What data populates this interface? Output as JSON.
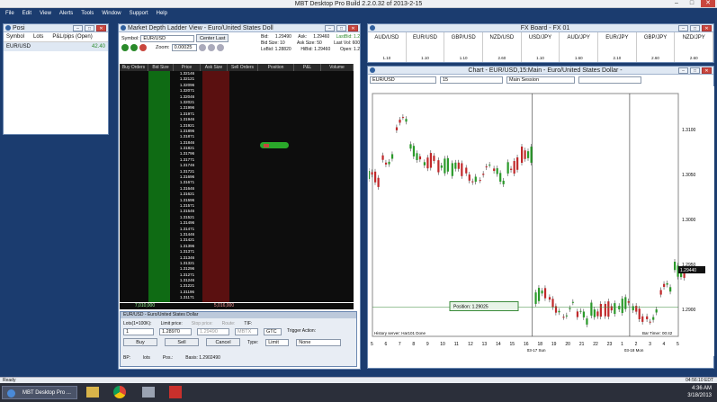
{
  "app": {
    "title": "MBT Desktop Pro Build 2.2.0.32 of 2013-2-15",
    "menu": [
      "File",
      "Edit",
      "View",
      "Alerts",
      "Tools",
      "Window",
      "Support",
      "Help"
    ]
  },
  "positions": {
    "title": "Posi",
    "headers": [
      "Symbol",
      "Lots",
      "P&L/pips (Open)"
    ],
    "rows": [
      {
        "symbol": "EUR/USD",
        "pl": "42.40"
      }
    ]
  },
  "ladder": {
    "title": "Market Depth Ladder View - Euro/United States Doll",
    "symbol_label": "Symbol:",
    "symbol": "EUR/USD",
    "center": "Center Last",
    "bid_label": "Bid:",
    "bid": "1.29490",
    "ask_label": "Ask:",
    "ask": "1.29460",
    "bidsize": "Bid Size: 10",
    "asksize": "Ask Size: 50",
    "lastbid": "LastBid: 1.2",
    "lobid": "LoBid: 1.28820",
    "hibid": "HiBid: 1.29460",
    "lastvol": "Last Vol: 600",
    "open": "Open: 1.2",
    "zoom_label": "Zoom:",
    "zoom": "0.00025",
    "columns": [
      "Buy Orders",
      "Bid Size",
      "Price",
      "Ask Size",
      "Sell Orders",
      "Position",
      "P&L",
      "Volume"
    ],
    "prices": [
      "1.32146",
      "1.32121",
      "1.32096",
      "1.32071",
      "1.32046",
      "1.32021",
      "1.31996",
      "1.31971",
      "1.31946",
      "1.31921",
      "1.31896",
      "1.31871",
      "1.31846",
      "1.31821",
      "1.31796",
      "1.31771",
      "1.31746",
      "1.31721",
      "1.31696",
      "1.31671",
      "1.31646",
      "1.31621",
      "1.31596",
      "1.31571",
      "1.31546",
      "1.31521",
      "1.31496",
      "1.31471",
      "1.31446",
      "1.31421",
      "1.31396",
      "1.31371",
      "1.31346",
      "1.31321",
      "1.31296",
      "1.31271",
      "1.31246",
      "1.31221",
      "1.31196",
      "1.31171"
    ],
    "bid_total": "7,010,000",
    "ask_total": "5,016,000"
  },
  "order": {
    "title": "EUR/USD - Euro/United States Dollar",
    "lots_label": "Lots(1=100K):",
    "lots": "1",
    "limit_label": "Limit price:",
    "limit": "1.28970",
    "stop_label": "Stop price:",
    "stop": "1.29490",
    "route_label": "Route:",
    "route": "MBTX",
    "tif_label": "TIF:",
    "tif": "GTC",
    "buy": "Buy",
    "sell": "Sell",
    "cancel": "Cancel",
    "clear": "Clear",
    "type_label": "Type:",
    "type": "Limit",
    "trigger_label": "Trigger Action:",
    "trigger": "None",
    "bp": "BP:",
    "lots2": "lots",
    "pos": "Pos.:",
    "basis": "Basis: 1.2902490"
  },
  "fxboard": {
    "title": "FX Board - FX 01",
    "pairs": [
      {
        "name": "AUD/USD",
        "v": "1.10"
      },
      {
        "name": "EUR/USD",
        "v": "1.10"
      },
      {
        "name": "GBP/USD",
        "v": "1.10"
      },
      {
        "name": "NZD/USD",
        "v": "2.60"
      },
      {
        "name": "USD/JPY",
        "v": "1.10"
      },
      {
        "name": "AUD/JPY",
        "v": "1.60"
      },
      {
        "name": "EUR/JPY",
        "v": "2.10"
      },
      {
        "name": "GBP/JPY",
        "v": "2.60"
      },
      {
        "name": "NZD/JPY",
        "v": "2.60"
      }
    ]
  },
  "chart": {
    "title": "Chart - EUR/USD,15:Main - Euro/United States Dollar -",
    "symbol": "EUR/USD",
    "interval": "15",
    "session": "Main Session",
    "position_label": "Position:",
    "position_val": "1.29025",
    "history": "History server: Har101 Done",
    "bartimer": "Bar Timer: 00:42",
    "date1": "03-17 Sun",
    "date2": "03-18 Mon",
    "last_price": "1.29440"
  },
  "chart_data": {
    "type": "line",
    "title": "",
    "xlabel": "",
    "ylabel": "",
    "ylim": [
      1.287,
      1.314
    ],
    "x": [
      "5",
      "6",
      "7",
      "8",
      "9",
      "10",
      "11",
      "12",
      "13",
      "14",
      "15",
      "16",
      "18",
      "19",
      "20",
      "21",
      "22",
      "23",
      "1",
      "2",
      "3",
      "4",
      "5"
    ],
    "yticks": [
      "1.3100",
      "1.3050",
      "1.3000",
      "1.2950",
      "1.2900"
    ],
    "series": [
      {
        "name": "",
        "values": [
          1.3045,
          1.307,
          1.3105,
          1.3075,
          1.3065,
          1.306,
          1.3055,
          1.305,
          1.3052,
          1.3048,
          1.306,
          1.3072,
          1.2915,
          1.2905,
          1.29,
          1.289,
          1.29,
          1.29,
          1.2905,
          1.2895,
          1.2895,
          1.292,
          1.2944
        ]
      }
    ]
  },
  "status": {
    "ready": "Ready",
    "time": "04:56:10 EDT",
    "clock": "4:36 AM",
    "date": "3/18/2013",
    "task": "MBT Desktop Pro ..."
  }
}
